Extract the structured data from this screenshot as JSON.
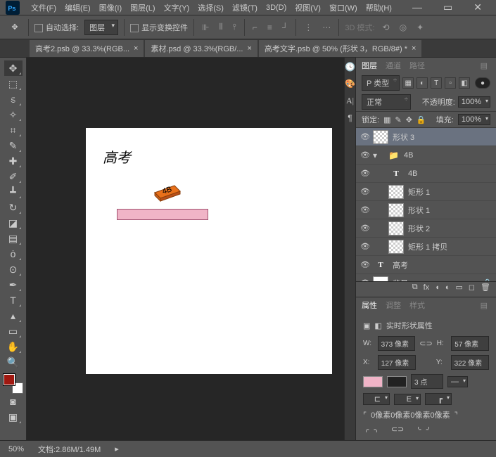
{
  "menu": {
    "file": "文件(F)",
    "edit": "编辑(E)",
    "image": "图像(I)",
    "layer": "图层(L)",
    "type": "文字(Y)",
    "select": "选择(S)",
    "filter": "滤镜(T)",
    "threed": "3D(D)",
    "view": "视图(V)",
    "window": "窗口(W)",
    "help": "帮助(H)"
  },
  "options": {
    "auto_select": "自动选择:",
    "target": "图层",
    "show_transform": "显示变换控件",
    "threed_mode": "3D 模式:"
  },
  "tabs": [
    {
      "label": "高考2.psb @ 33.3%(RGB..."
    },
    {
      "label": "素材.psd @ 33.3%(RGB/..."
    },
    {
      "label": "高考文字.psb @ 50% (形状 3，RGB/8#) *"
    }
  ],
  "canvas_text": "高考",
  "eraser_text": "4B",
  "layers_panel": {
    "tabs": {
      "layers": "图层",
      "channels": "通道",
      "paths": "路径"
    },
    "filter": "P 类型",
    "blend_mode": "正常",
    "opacity_label": "不透明度:",
    "opacity": "100%",
    "lock_label": "锁定:",
    "fill_label": "填充:",
    "fill": "100%",
    "layers": [
      {
        "name": "形状 3",
        "type": "shape",
        "selected": true
      },
      {
        "name": "4B",
        "type": "group"
      },
      {
        "name": "4B",
        "type": "text",
        "indent": 1
      },
      {
        "name": "矩形 1",
        "type": "shape",
        "indent": 1
      },
      {
        "name": "形状 1",
        "type": "shape",
        "indent": 1
      },
      {
        "name": "形状 2",
        "type": "shape",
        "indent": 1
      },
      {
        "name": "矩形 1 拷贝",
        "type": "shape",
        "indent": 1
      },
      {
        "name": "高考",
        "type": "text"
      },
      {
        "name": "背景",
        "type": "white",
        "locked": true
      }
    ]
  },
  "properties": {
    "tabs": {
      "properties": "属性",
      "adjustments": "调整",
      "styles": "样式"
    },
    "title": "实时形状属性",
    "w_label": "W:",
    "w": "373 像素",
    "h_label": "H:",
    "h": "57 像素",
    "x_label": "X:",
    "x": "127 像素",
    "y_label": "Y:",
    "y": "322 像素",
    "stroke": "3 点",
    "corners": "0像素0像素0像素0像素",
    "shape_color": "#f0b4c7"
  },
  "fg_color": "#a01810",
  "status": {
    "zoom": "50%",
    "doc": "文档:2.86M/1.49M"
  }
}
